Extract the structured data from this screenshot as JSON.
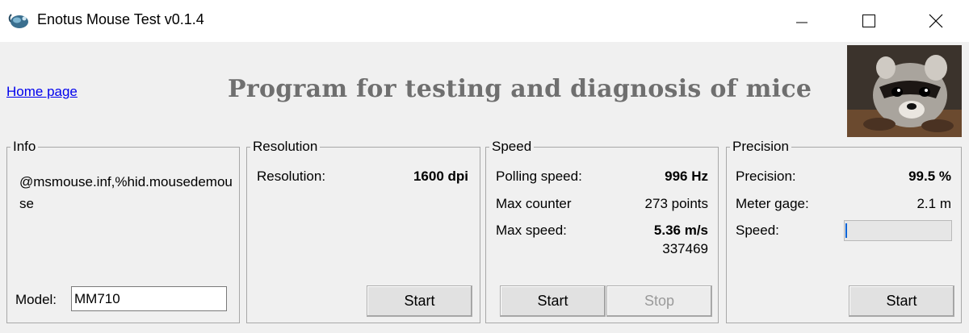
{
  "window": {
    "title": "Enotus Mouse Test v0.1.4",
    "icon": "mouse-app-icon"
  },
  "header": {
    "home_link": "Home page",
    "program_title": "Program for testing and diagnosis of mice"
  },
  "info": {
    "legend": "Info",
    "text": "@msmouse.inf,%hid.mousedemouse",
    "model_label": "Model:",
    "model_value": "MM710"
  },
  "resolution": {
    "legend": "Resolution",
    "label": "Resolution:",
    "value": "1600 dpi",
    "start_label": "Start"
  },
  "speed": {
    "legend": "Speed",
    "polling_label": "Polling speed:",
    "polling_value": "996 Hz",
    "counter_label": "Max counter",
    "counter_value": "273 points",
    "maxspeed_label": "Max  speed:",
    "maxspeed_value": "5.36 m/s",
    "maxspeed_sub": "337469",
    "start_label": "Start",
    "stop_label": "Stop"
  },
  "precision": {
    "legend": "Precision",
    "precision_label": "Precision:",
    "precision_value": "99.5 %",
    "gage_label": "Meter gage:",
    "gage_value": "2.1 m",
    "speed_label": "Speed:",
    "speed_level": 0,
    "start_label": "Start"
  },
  "colors": {
    "link": "#0000ee",
    "title_gray": "#6f6f6f",
    "progress_blue": "#0a64d8"
  }
}
